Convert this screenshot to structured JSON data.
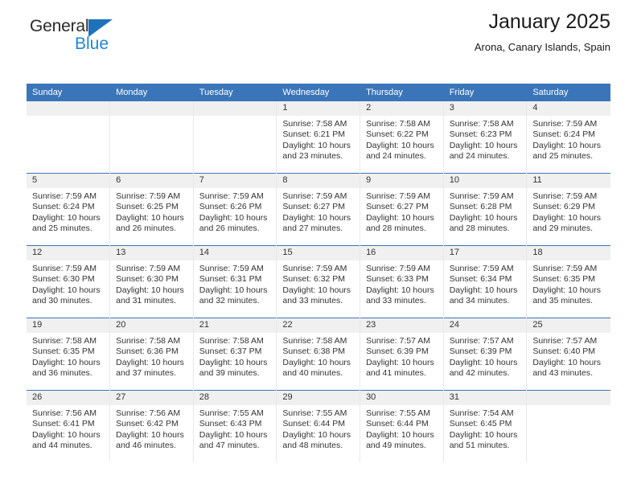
{
  "logo": {
    "text_top": "General",
    "text_bottom": "Blue",
    "triangle_color": "#1e72bb",
    "blue_color": "#1e86d6"
  },
  "header": {
    "title": "January 2025",
    "subtitle": "Arona, Canary Islands, Spain",
    "accent_color": "#3b75b9"
  },
  "calendar": {
    "weekday_headers": [
      "Sunday",
      "Monday",
      "Tuesday",
      "Wednesday",
      "Thursday",
      "Friday",
      "Saturday"
    ],
    "weeks": [
      [
        {
          "day": "",
          "lines": []
        },
        {
          "day": "",
          "lines": []
        },
        {
          "day": "",
          "lines": []
        },
        {
          "day": "1",
          "lines": [
            "Sunrise: 7:58 AM",
            "Sunset: 6:21 PM",
            "Daylight: 10 hours",
            "and 23 minutes."
          ]
        },
        {
          "day": "2",
          "lines": [
            "Sunrise: 7:58 AM",
            "Sunset: 6:22 PM",
            "Daylight: 10 hours",
            "and 24 minutes."
          ]
        },
        {
          "day": "3",
          "lines": [
            "Sunrise: 7:58 AM",
            "Sunset: 6:23 PM",
            "Daylight: 10 hours",
            "and 24 minutes."
          ]
        },
        {
          "day": "4",
          "lines": [
            "Sunrise: 7:59 AM",
            "Sunset: 6:24 PM",
            "Daylight: 10 hours",
            "and 25 minutes."
          ]
        }
      ],
      [
        {
          "day": "5",
          "lines": [
            "Sunrise: 7:59 AM",
            "Sunset: 6:24 PM",
            "Daylight: 10 hours",
            "and 25 minutes."
          ]
        },
        {
          "day": "6",
          "lines": [
            "Sunrise: 7:59 AM",
            "Sunset: 6:25 PM",
            "Daylight: 10 hours",
            "and 26 minutes."
          ]
        },
        {
          "day": "7",
          "lines": [
            "Sunrise: 7:59 AM",
            "Sunset: 6:26 PM",
            "Daylight: 10 hours",
            "and 26 minutes."
          ]
        },
        {
          "day": "8",
          "lines": [
            "Sunrise: 7:59 AM",
            "Sunset: 6:27 PM",
            "Daylight: 10 hours",
            "and 27 minutes."
          ]
        },
        {
          "day": "9",
          "lines": [
            "Sunrise: 7:59 AM",
            "Sunset: 6:27 PM",
            "Daylight: 10 hours",
            "and 28 minutes."
          ]
        },
        {
          "day": "10",
          "lines": [
            "Sunrise: 7:59 AM",
            "Sunset: 6:28 PM",
            "Daylight: 10 hours",
            "and 28 minutes."
          ]
        },
        {
          "day": "11",
          "lines": [
            "Sunrise: 7:59 AM",
            "Sunset: 6:29 PM",
            "Daylight: 10 hours",
            "and 29 minutes."
          ]
        }
      ],
      [
        {
          "day": "12",
          "lines": [
            "Sunrise: 7:59 AM",
            "Sunset: 6:30 PM",
            "Daylight: 10 hours",
            "and 30 minutes."
          ]
        },
        {
          "day": "13",
          "lines": [
            "Sunrise: 7:59 AM",
            "Sunset: 6:30 PM",
            "Daylight: 10 hours",
            "and 31 minutes."
          ]
        },
        {
          "day": "14",
          "lines": [
            "Sunrise: 7:59 AM",
            "Sunset: 6:31 PM",
            "Daylight: 10 hours",
            "and 32 minutes."
          ]
        },
        {
          "day": "15",
          "lines": [
            "Sunrise: 7:59 AM",
            "Sunset: 6:32 PM",
            "Daylight: 10 hours",
            "and 33 minutes."
          ]
        },
        {
          "day": "16",
          "lines": [
            "Sunrise: 7:59 AM",
            "Sunset: 6:33 PM",
            "Daylight: 10 hours",
            "and 33 minutes."
          ]
        },
        {
          "day": "17",
          "lines": [
            "Sunrise: 7:59 AM",
            "Sunset: 6:34 PM",
            "Daylight: 10 hours",
            "and 34 minutes."
          ]
        },
        {
          "day": "18",
          "lines": [
            "Sunrise: 7:59 AM",
            "Sunset: 6:35 PM",
            "Daylight: 10 hours",
            "and 35 minutes."
          ]
        }
      ],
      [
        {
          "day": "19",
          "lines": [
            "Sunrise: 7:58 AM",
            "Sunset: 6:35 PM",
            "Daylight: 10 hours",
            "and 36 minutes."
          ]
        },
        {
          "day": "20",
          "lines": [
            "Sunrise: 7:58 AM",
            "Sunset: 6:36 PM",
            "Daylight: 10 hours",
            "and 37 minutes."
          ]
        },
        {
          "day": "21",
          "lines": [
            "Sunrise: 7:58 AM",
            "Sunset: 6:37 PM",
            "Daylight: 10 hours",
            "and 39 minutes."
          ]
        },
        {
          "day": "22",
          "lines": [
            "Sunrise: 7:58 AM",
            "Sunset: 6:38 PM",
            "Daylight: 10 hours",
            "and 40 minutes."
          ]
        },
        {
          "day": "23",
          "lines": [
            "Sunrise: 7:57 AM",
            "Sunset: 6:39 PM",
            "Daylight: 10 hours",
            "and 41 minutes."
          ]
        },
        {
          "day": "24",
          "lines": [
            "Sunrise: 7:57 AM",
            "Sunset: 6:39 PM",
            "Daylight: 10 hours",
            "and 42 minutes."
          ]
        },
        {
          "day": "25",
          "lines": [
            "Sunrise: 7:57 AM",
            "Sunset: 6:40 PM",
            "Daylight: 10 hours",
            "and 43 minutes."
          ]
        }
      ],
      [
        {
          "day": "26",
          "lines": [
            "Sunrise: 7:56 AM",
            "Sunset: 6:41 PM",
            "Daylight: 10 hours",
            "and 44 minutes."
          ]
        },
        {
          "day": "27",
          "lines": [
            "Sunrise: 7:56 AM",
            "Sunset: 6:42 PM",
            "Daylight: 10 hours",
            "and 46 minutes."
          ]
        },
        {
          "day": "28",
          "lines": [
            "Sunrise: 7:55 AM",
            "Sunset: 6:43 PM",
            "Daylight: 10 hours",
            "and 47 minutes."
          ]
        },
        {
          "day": "29",
          "lines": [
            "Sunrise: 7:55 AM",
            "Sunset: 6:44 PM",
            "Daylight: 10 hours",
            "and 48 minutes."
          ]
        },
        {
          "day": "30",
          "lines": [
            "Sunrise: 7:55 AM",
            "Sunset: 6:44 PM",
            "Daylight: 10 hours",
            "and 49 minutes."
          ]
        },
        {
          "day": "31",
          "lines": [
            "Sunrise: 7:54 AM",
            "Sunset: 6:45 PM",
            "Daylight: 10 hours",
            "and 51 minutes."
          ]
        },
        {
          "day": "",
          "lines": []
        }
      ]
    ]
  }
}
